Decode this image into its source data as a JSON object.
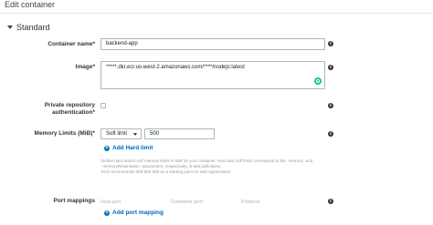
{
  "header": {
    "title": "Edit container"
  },
  "section": {
    "title": "Standard"
  },
  "container_name": {
    "label": "Container name*",
    "value": "backend-app"
  },
  "image": {
    "label": "Image*",
    "value": "*****.dkr.ecr.us-west-2.amazonaws.com/****/nodejs:latest"
  },
  "private_repo": {
    "label_line1": "Private repository",
    "label_line2": "authentication*",
    "checked": false
  },
  "memory_limits": {
    "label": "Memory Limits (MiB)*",
    "select_value": "Soft limit",
    "value": "500",
    "add_label": "Add Hard limit",
    "help_line1": "Define hard and/or soft memory limits in MiB for your container. Hard and soft limits correspond to the `memory` and",
    "help_line2": "`memoryReservation` parameters, respectively, in task definitions.",
    "help_line3": "ECS recommends 300-500 MiB as a starting point for web applications."
  },
  "port_mappings": {
    "label": "Port mappings",
    "columns": [
      "Host port",
      "Container port",
      "Protocol"
    ],
    "add_label": "Add port mapping"
  }
}
